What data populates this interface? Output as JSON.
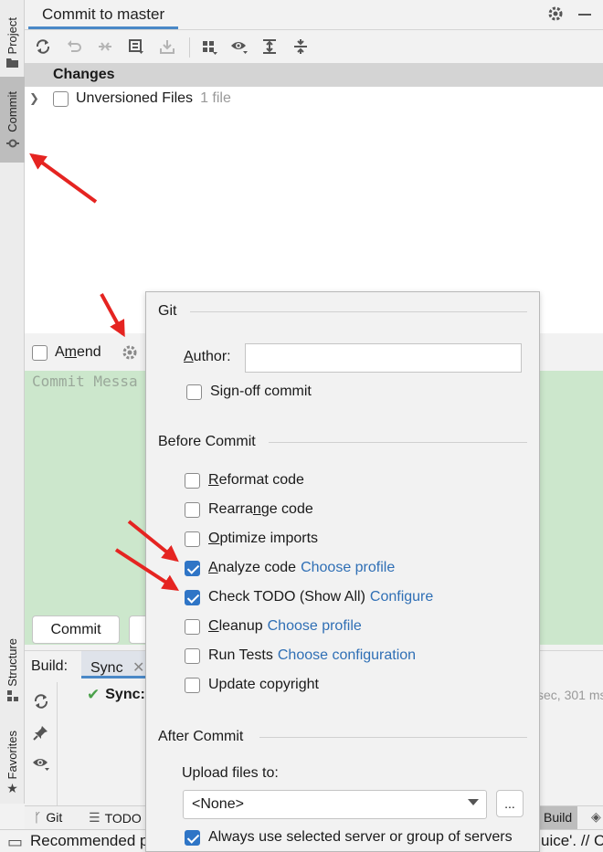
{
  "left_strip": {
    "tabs": [
      {
        "label": "Project",
        "icon": "folder-icon"
      },
      {
        "label": "Commit",
        "icon": "commit-icon"
      },
      {
        "label": "Structure",
        "icon": "structure-icon"
      },
      {
        "label": "Favorites",
        "icon": "star-icon"
      }
    ]
  },
  "header": {
    "tab_label": "Commit to master",
    "settings_icon": "gear-icon",
    "minimize_icon": "minimize-icon"
  },
  "toolbar": {
    "icons": [
      "refresh-icon",
      "rollback-icon",
      "diff-icon",
      "commit-message-history-icon",
      "shelve-icon",
      "group-by-icon",
      "view-options-icon",
      "expand-all-icon",
      "collapse-all-icon"
    ]
  },
  "changes": {
    "header": "Changes",
    "unversioned_label": "Unversioned Files",
    "unversioned_count": "1 file"
  },
  "amend": {
    "label_pre": "A",
    "label_mnemonic": "m",
    "label_post": "end"
  },
  "message": {
    "placeholder": "Commit Messa"
  },
  "commit_button": {
    "label": "Commit"
  },
  "build": {
    "label": "Build:",
    "tab": "Sync",
    "sync_text": "Sync:",
    "time_text": "sec, 301 ms"
  },
  "bottom_tabs": {
    "git": "Git",
    "todo": "TODO",
    "build": "Build"
  },
  "status": {
    "left_text": "Recommended p",
    "right_text": "uice'. // C"
  },
  "popup": {
    "git_title": "Git",
    "author_label_mnemonic": "A",
    "author_label_rest": "uthor:",
    "author_value": "",
    "signoff_label": "Sign-off commit",
    "before_title": "Before Commit",
    "options": [
      {
        "pre": "",
        "mn": "R",
        "post": "eformat code",
        "checked": false,
        "link": ""
      },
      {
        "pre": "Rearra",
        "mn": "n",
        "post": "ge code",
        "checked": false,
        "link": ""
      },
      {
        "pre": "",
        "mn": "O",
        "post": "ptimize imports",
        "checked": false,
        "link": ""
      },
      {
        "pre": "",
        "mn": "A",
        "post": "nalyze code",
        "checked": true,
        "link": "Choose profile"
      },
      {
        "pre": "Check TODO (Show All)",
        "mn": "",
        "post": "",
        "checked": true,
        "link": "Configure"
      },
      {
        "pre": "",
        "mn": "C",
        "post": "leanup",
        "checked": false,
        "link": "Choose profile"
      },
      {
        "pre": "Run Tests",
        "mn": "",
        "post": "",
        "checked": false,
        "link": "Choose configuration"
      },
      {
        "pre": "Update copyright",
        "mn": "",
        "post": "",
        "checked": false,
        "link": ""
      }
    ],
    "after_title": "After Commit",
    "upload_label": "Upload files to:",
    "upload_value": "<None>",
    "browse_label": "...",
    "always_use_label": "Always use selected server or group of servers"
  },
  "colors": {
    "accent": "#2f75c6",
    "link": "#2f6fb5",
    "message_bg": "#cce7cc",
    "annotation_arrow": "#e52421"
  }
}
